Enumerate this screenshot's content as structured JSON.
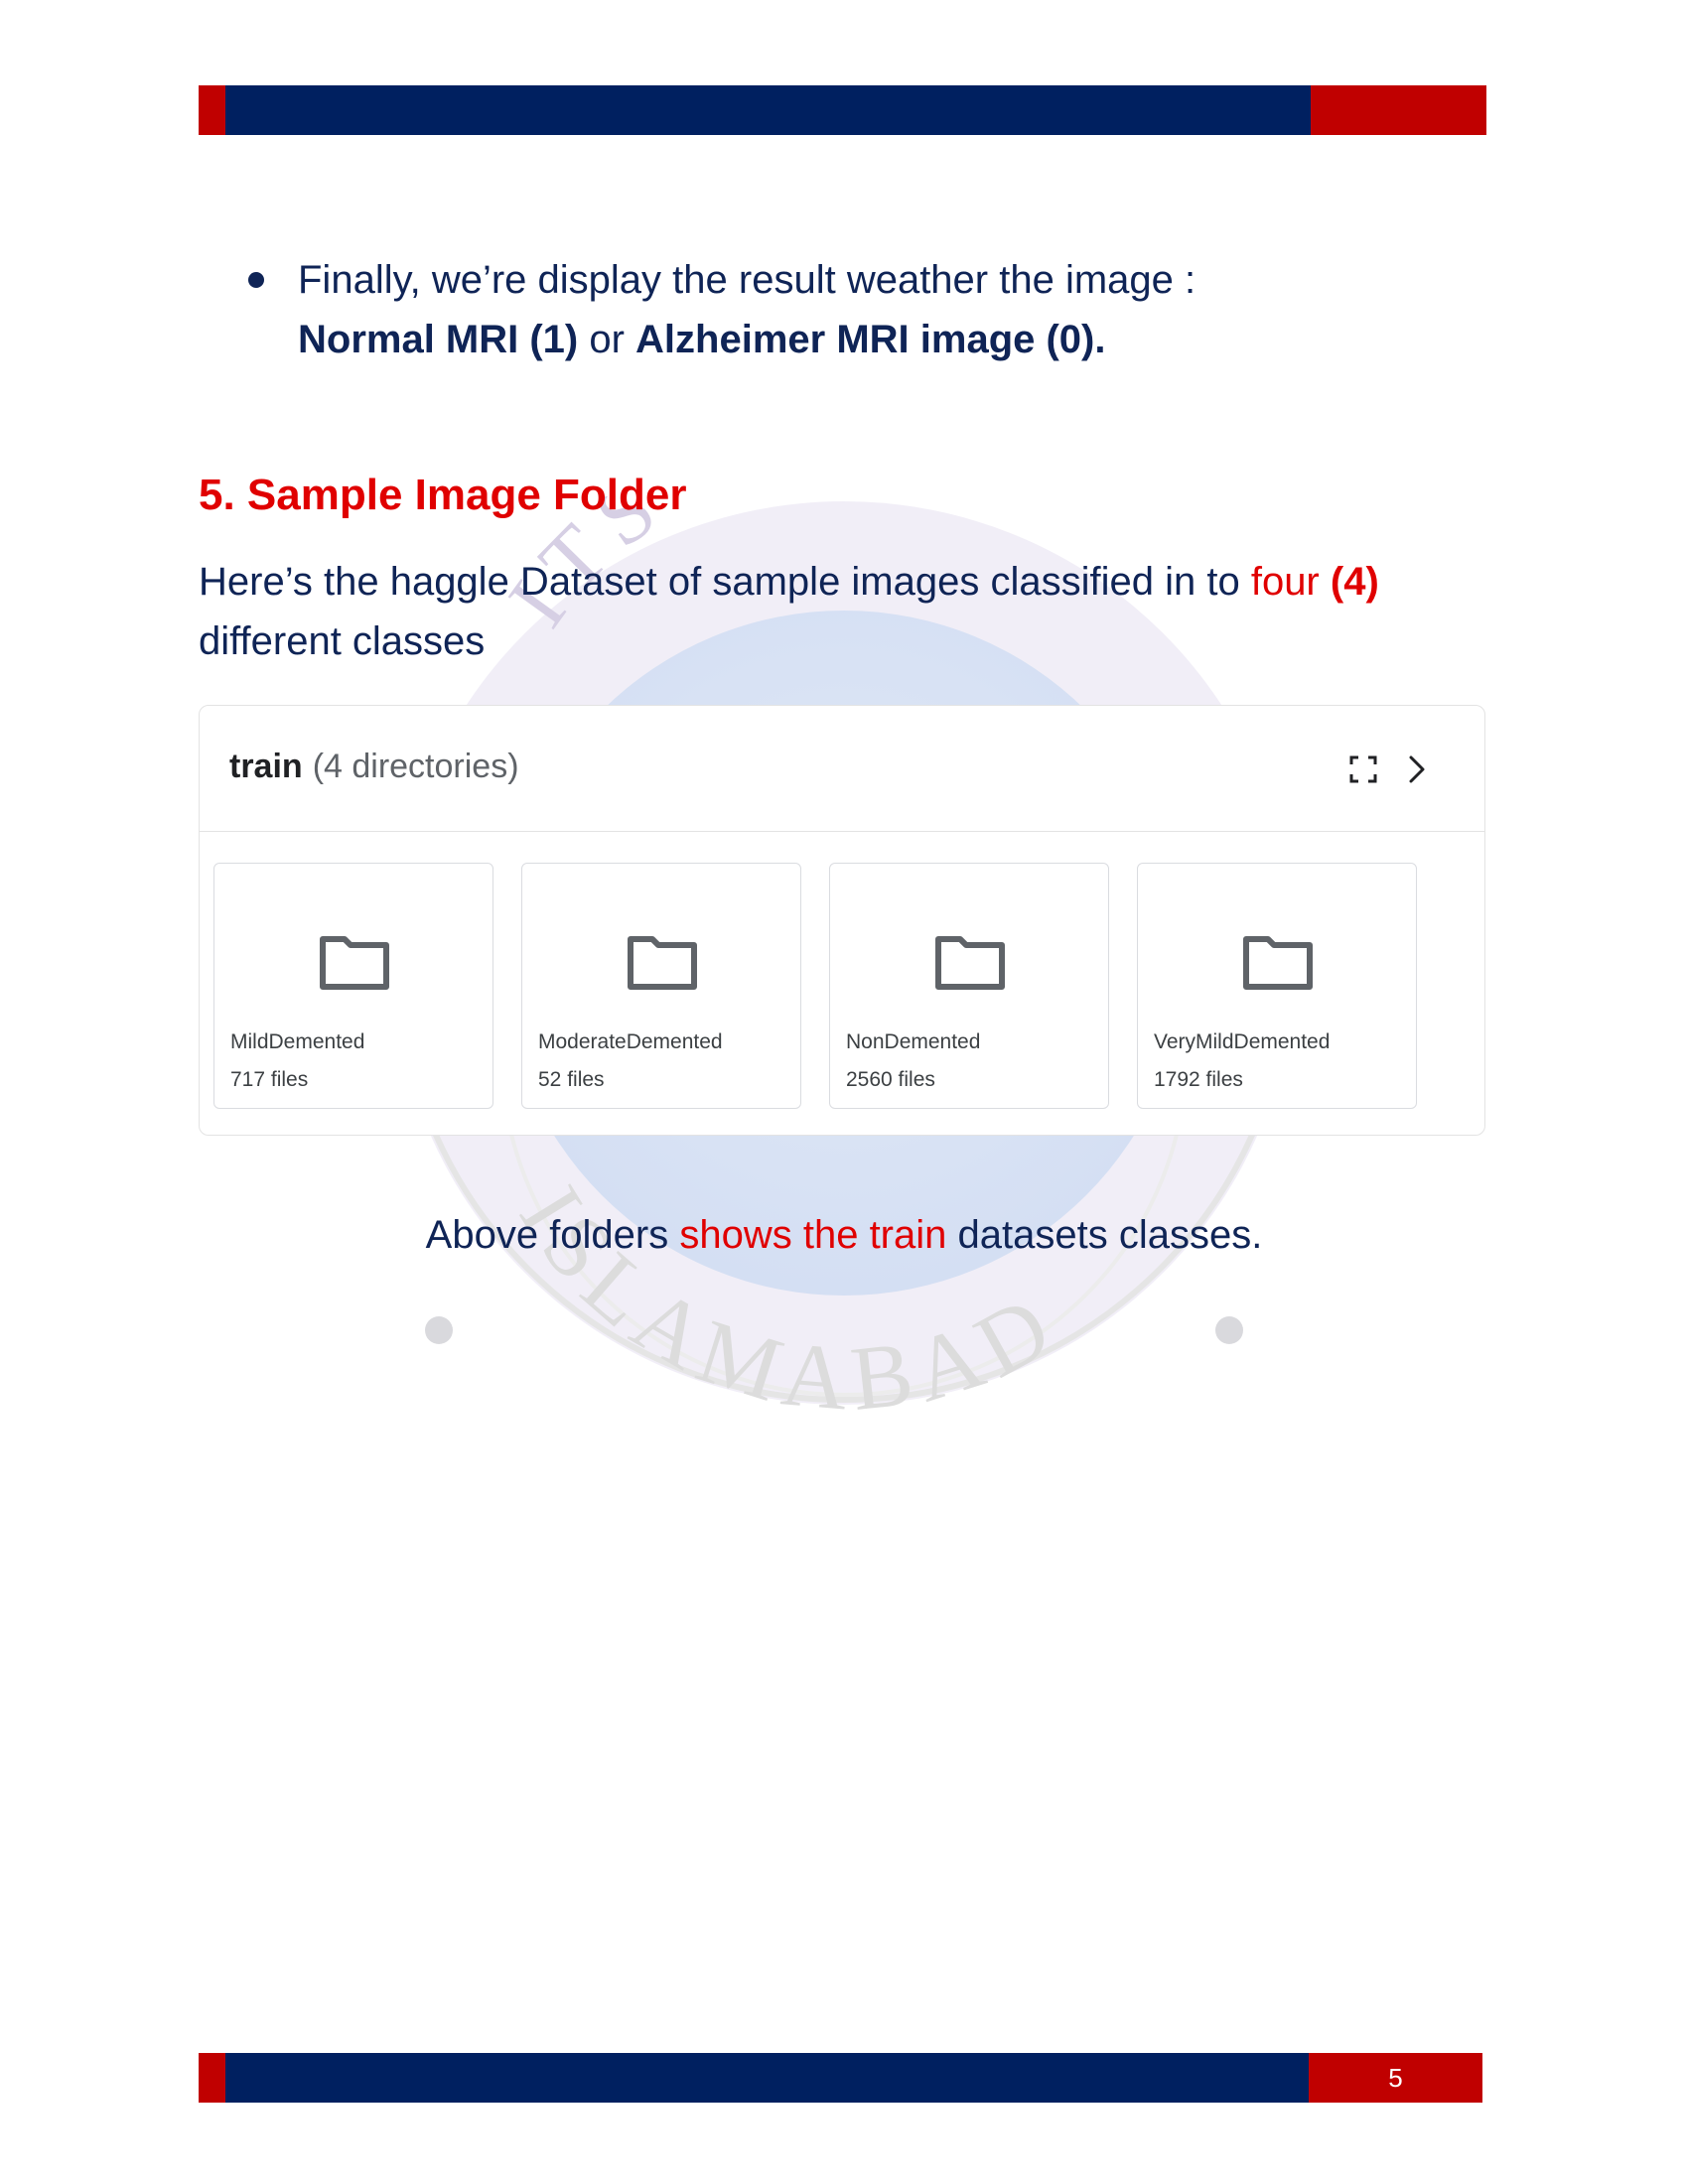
{
  "bullet": {
    "line1": "Finally, we’re display the result weather the image :",
    "normal": "Normal MRI (1)",
    "or": " or ",
    "alzheimer": "Alzheimer MRI image (0)."
  },
  "section": {
    "heading": "5. Sample Image Folder",
    "para_start": "Here’s the haggle Dataset of sample images classified in to ",
    "para_four": "four",
    "para_four_num": "(4)",
    "para_end": "different classes"
  },
  "panel": {
    "title": "train",
    "subtitle": "(4 directories)",
    "folders": [
      {
        "name": "MildDemented",
        "count": "717 files"
      },
      {
        "name": "ModerateDemented",
        "count": "52 files"
      },
      {
        "name": "NonDemented",
        "count": "2560 files"
      },
      {
        "name": "VeryMildDemented",
        "count": "1792 files"
      }
    ]
  },
  "caption": {
    "start": "Above folders ",
    "highlight": "shows the train",
    "end": " datasets classes."
  },
  "watermark": {
    "top_text": "ITS UNIV",
    "bottom_text": "ISLAMABAD"
  },
  "footer": {
    "page_number": "5"
  },
  "colors": {
    "navy": "#002060",
    "red": "#c00000",
    "text": "#0f2456",
    "accent_red": "#e00000"
  }
}
